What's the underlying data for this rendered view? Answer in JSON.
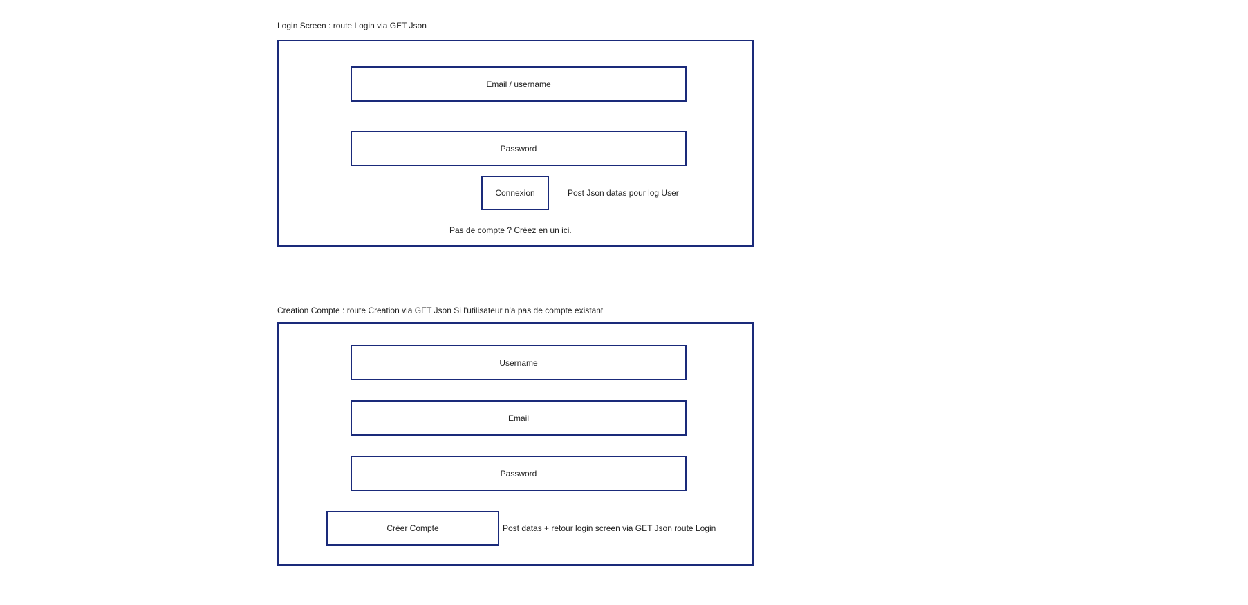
{
  "login_section": {
    "caption": "Login Screen : route Login via GET Json",
    "email_field": "Email / username",
    "password_field": "Password",
    "connect_button": "Connexion",
    "connect_note": "Post Json datas pour log User",
    "signup_link": "Pas de compte ? Créez en un ici."
  },
  "create_section": {
    "caption": "Creation Compte : route Creation via GET Json Si l'utilisateur n'a pas de compte existant",
    "username_field": "Username",
    "email_field": "Email",
    "password_field": "Password",
    "create_button": "Créer Compte",
    "create_note": "Post datas + retour login screen via GET Json route Login"
  },
  "colors": {
    "border": "#1a2a7a",
    "text": "#222222",
    "background": "#ffffff"
  }
}
